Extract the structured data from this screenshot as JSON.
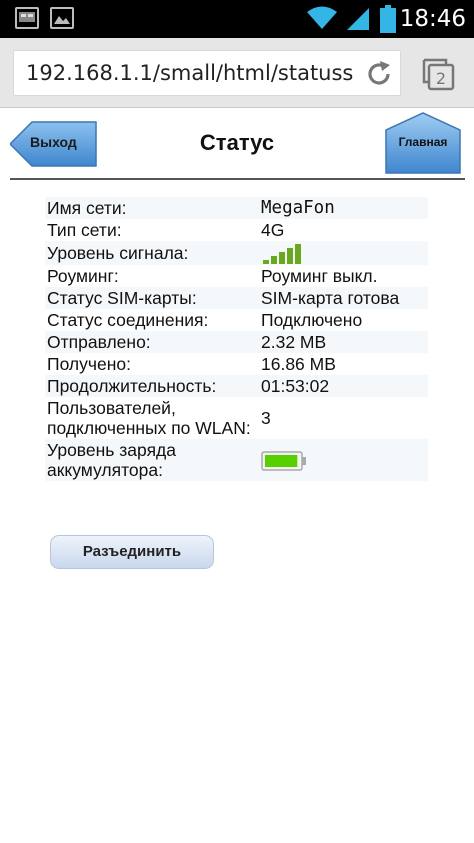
{
  "statusbar": {
    "time": "18:46",
    "tab_count": "2",
    "signal_bars": 4,
    "battery_level": 0.9
  },
  "browser": {
    "url": "192.168.1.1/small/html/statuss"
  },
  "header": {
    "back_label": "Выход",
    "title": "Статус",
    "home_label": "Главная"
  },
  "status": {
    "rows": [
      {
        "label": "Имя сети:",
        "value": "MegaFon"
      },
      {
        "label": "Тип сети:",
        "value": "4G"
      },
      {
        "label": "Уровень сигнала:",
        "value": ""
      },
      {
        "label": "Роуминг:",
        "value": "Роуминг выкл."
      },
      {
        "label": "Статус SIM-карты:",
        "value": "SIM-карта готова"
      },
      {
        "label": "Статус соединения:",
        "value": "Подключено"
      },
      {
        "label": "Отправлено:",
        "value": "2.32 MB"
      },
      {
        "label": "Получено:",
        "value": "16.86 MB"
      },
      {
        "label": "Продолжительность:",
        "value": "01:53:02"
      },
      {
        "label": "Пользователей, подключенных по WLAN:",
        "value": "3"
      },
      {
        "label": "Уровень заряда аккумулятора:",
        "value": ""
      }
    ],
    "signal_level": 5,
    "battery_level": 0.95
  },
  "actions": {
    "disconnect_label": "Разъединить"
  },
  "colors": {
    "accent_blue": "#5a9ad8",
    "signal_green": "#6aa81f",
    "battery_green": "#58d000",
    "status_icon_blue": "#33b5e5"
  }
}
